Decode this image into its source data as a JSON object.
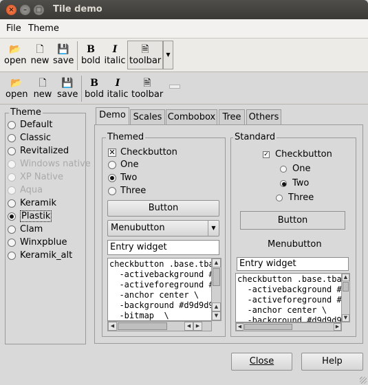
{
  "window": {
    "title": "Tile demo"
  },
  "menubar": {
    "file": "File",
    "theme": "Theme"
  },
  "toolbar1": {
    "open": "open",
    "new": "new",
    "save": "save",
    "bold": "bold",
    "italic": "italic",
    "toolbar": "toolbar"
  },
  "toolbar2": {
    "open": "open",
    "new": "new",
    "save": "save",
    "bold": "bold",
    "italic": "italic",
    "toolbar": "toolbar"
  },
  "theme_panel": {
    "label": "Theme",
    "items": [
      {
        "label": "Default",
        "state": "enabled"
      },
      {
        "label": "Classic",
        "state": "enabled"
      },
      {
        "label": "Revitalized",
        "state": "enabled"
      },
      {
        "label": "Windows native",
        "state": "disabled"
      },
      {
        "label": "XP Native",
        "state": "disabled"
      },
      {
        "label": "Aqua",
        "state": "disabled"
      },
      {
        "label": "Keramik",
        "state": "enabled"
      },
      {
        "label": "Plastik",
        "state": "selected"
      },
      {
        "label": "Clam",
        "state": "enabled"
      },
      {
        "label": "Winxpblue",
        "state": "enabled"
      },
      {
        "label": "Keramik_alt",
        "state": "enabled"
      }
    ]
  },
  "tabs": [
    "Demo",
    "Scales",
    "Combobox",
    "Tree",
    "Others"
  ],
  "themed": {
    "label": "Themed",
    "checkbutton": "Checkbutton",
    "one": "One",
    "two": "Two",
    "three": "Three",
    "button": "Button",
    "menubutton": "Menubutton",
    "entry": "Entry widget",
    "text_lines": [
      "checkbutton .base.tba",
      "  -activebackground #",
      "  -activeforeground #",
      "  -anchor center \\",
      "  -background #d9d9d9",
      "  -bitmap  \\"
    ]
  },
  "standard": {
    "label": "Standard",
    "checkbutton": "Checkbutton",
    "one": "One",
    "two": "Two",
    "three": "Three",
    "button": "Button",
    "menubutton": "Menubutton",
    "entry": "Entry widget",
    "text_lines": [
      "checkbutton .base.tba",
      "  -activebackground #d",
      "  -activeforeground #0",
      "  -anchor center \\",
      "  -background #d9d9d9"
    ]
  },
  "footer": {
    "close": "Close",
    "help": "Help"
  }
}
